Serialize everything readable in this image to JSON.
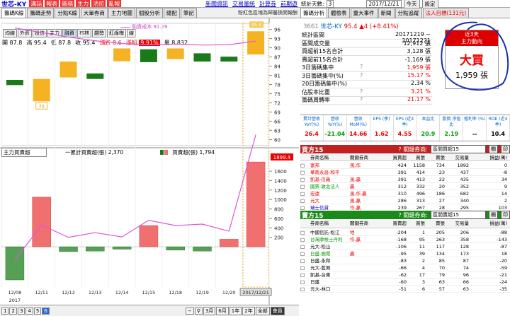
{
  "header": {
    "symbol": "世芯-KY",
    "buttons": [
      "溝話",
      "報表",
      "圖務",
      "主力",
      "活拉",
      "亂報"
    ],
    "links": [
      "新聞資訊",
      "交易量統",
      "計算券",
      "前期遊"
    ],
    "tabs": [
      "籌碼K線",
      "籌碼走勢",
      "分點K線",
      "大單券商",
      "主力地圖",
      "個股分析",
      "總配",
      "筆記"
    ],
    "subtitle": "粉紅色區塊為歸屬換開報酬"
  },
  "right_header": {
    "label": "統計天數:",
    "days": "3",
    "date": "2017/12/21",
    "today": "今天",
    "settings": "設定",
    "tabs": [
      "籌碼分析",
      "體檢表",
      "重大事件",
      "新聞",
      "分點追蹤",
      "法人目標(131元)"
    ]
  },
  "chart": {
    "legend": "融資成本 91.29",
    "tools": [
      "均線",
      "外資",
      "投信",
      "主力",
      "融資",
      "布林",
      "趨勢",
      "紅綠梅",
      "線"
    ],
    "info": {
      "open": "開 87.8",
      "high": "高 95.4",
      "low": "低 87.8",
      "close": "收 95.4",
      "chg": "漲跌 8.6",
      "pct_label": "漲幅",
      "pct": "9.91%",
      "vol": "量 8,832"
    },
    "yticks_upper": [
      "96",
      "93",
      "90",
      "87",
      "84",
      "81",
      "78",
      "75",
      "72",
      "69",
      "66",
      "63",
      "60"
    ],
    "bubble_upper": "95.4",
    "bubble_72": "72",
    "lower_select": "主力買賣超",
    "lower_cum": "一累計買賣超(張) 2,370",
    "lower_day": "買賣超(張) 1,794",
    "yticks_lower": [
      "1600",
      "1400",
      "1200",
      "1000",
      "800",
      "600",
      "400",
      "200"
    ],
    "bubble_lower": "1899.4",
    "xlabels": [
      "12/08",
      "12/11",
      "12/12",
      "12/13",
      "12/14",
      "12/15",
      "12/18",
      "12/19",
      "12/20",
      "2017/12/21"
    ],
    "year": "2017",
    "colors": {
      "up": "#f5b324",
      "down": "#1a7a1a",
      "bar_pos": "#f07070",
      "bar_neg": "#55a055",
      "ma": "#dd55dd"
    }
  },
  "chart_data": {
    "type": "bar",
    "categories": [
      "12/08",
      "12/11",
      "12/12",
      "12/13",
      "12/14",
      "12/15",
      "12/18",
      "12/19",
      "12/20",
      "2017/12/21"
    ],
    "candles": [
      {
        "open": 79.5,
        "close": 77.8,
        "high": 79.5,
        "low": 77.8
      },
      {
        "open": 72.5,
        "close": 79.8,
        "high": 79.8,
        "low": 72.5
      },
      {
        "open": 80.3,
        "close": 85.5,
        "high": 85.5,
        "low": 80.3
      },
      {
        "open": 81.6,
        "close": 79.8,
        "high": 81.6,
        "low": 79.8
      },
      {
        "open": 85.6,
        "close": 89.8,
        "high": 89.8,
        "low": 85.6
      },
      {
        "open": 89.5,
        "close": 85.3,
        "high": 89.5,
        "low": 85.3
      },
      {
        "open": 86.3,
        "close": 89.8,
        "high": 89.8,
        "low": 86.3
      },
      {
        "open": 88.2,
        "close": 85.5,
        "high": 88.2,
        "low": 85.5
      },
      {
        "open": 87.1,
        "close": 85.5,
        "high": 87.1,
        "low": 85.5
      },
      {
        "open": 87.8,
        "close": 95.4,
        "high": 95.4,
        "low": 87.8
      }
    ],
    "ma": [
      96.5,
      95.0,
      93.5,
      92.3,
      91.4,
      91.0,
      91.2,
      90.9,
      91.0,
      92.2
    ],
    "bars": [
      -700,
      1050,
      -100,
      -90,
      -50,
      450,
      -70,
      -90,
      160,
      1794
    ],
    "cum": [
      -280,
      460,
      200,
      300,
      210,
      560,
      450,
      480,
      330,
      2370
    ],
    "ylim_upper": [
      58,
      98
    ],
    "ylim_lower": [
      -850,
      1900
    ]
  },
  "stats": {
    "symbol_code": "3661",
    "symbol_name": "世芯-KY",
    "symbol_price": "95.4",
    "symbol_chg": "▲4 (+8.41%)",
    "rows": [
      {
        "label": "統計區間",
        "val": "20171219 ~ 20171221",
        "color": ""
      },
      {
        "label": "區間成交量",
        "val": "12,912 張",
        "color": ""
      },
      {
        "label": "買超前15名合計",
        "val": "3,128 張",
        "color": ""
      },
      {
        "label": "賣超前15名合計",
        "val": "-1,169 張",
        "color": ""
      },
      {
        "label": "3日籌碼集中",
        "val": "1,959 張",
        "color": "red"
      },
      {
        "label": "3日籌碼集中(%)",
        "val": "15.17 %",
        "color": "red"
      },
      {
        "label": "20日籌碼集中(%)",
        "val": "2.34 %",
        "color": ""
      },
      {
        "label": "佔股本比重",
        "val": "3.21 %",
        "color": "red"
      },
      {
        "label": "籌碼周轉率",
        "val": "21.17 %",
        "color": "red"
      }
    ],
    "callout_h1": "近3天",
    "callout_h2": "主力動向",
    "callout_big": "大買",
    "callout_num": "1,959 張"
  },
  "metrics": [
    {
      "h": "累計營收 YoY(%)",
      "v": "26.4",
      "c": "red"
    },
    {
      "h": "營收 YoY(%)",
      "v": "-21.04",
      "c": "grn"
    },
    {
      "h": "營收 MoM(%)",
      "v": "14.66",
      "c": "red"
    },
    {
      "h": "EPS (季)",
      "v": "1.62",
      "c": "red"
    },
    {
      "h": "EPS (近4季)",
      "v": "4.55",
      "c": "red"
    },
    {
      "h": "本益比",
      "v": "20.9",
      "c": "grn"
    },
    {
      "h": "股價 淨值比",
      "v": "2.19",
      "c": "grn"
    },
    {
      "h": "殖利率 (%)",
      "v": "--",
      "c": ""
    },
    {
      "h": "ROE (近4季)",
      "v": "10.4",
      "c": ""
    }
  ],
  "buy_table": {
    "title": "買方15",
    "sort_label": "? 關鍵券商:",
    "sort_value": "區間買超15",
    "btn1": "欄",
    "btn2": "印",
    "cols": [
      "券商名稱",
      "關鍵券商",
      "買賣超",
      "買張",
      "賣張",
      "交易量",
      "損益(萬)"
    ],
    "rows": [
      [
        "富邦",
        "風,作",
        "424",
        "1158",
        "734",
        "1892",
        "0",
        "red"
      ],
      [
        "華南永昌-和平",
        "",
        "391",
        "414",
        "23",
        "437",
        "-8",
        "red"
      ],
      [
        "凱基-信義",
        "風,贏",
        "391",
        "413",
        "22",
        "435",
        "34",
        "red"
      ],
      [
        "國票-敦北法人",
        "贏",
        "312",
        "332",
        "20",
        "352",
        "9",
        "grn"
      ],
      [
        "宏遠",
        "風,作,贏",
        "310",
        "496",
        "186",
        "682",
        "14",
        "red"
      ],
      [
        "元大",
        "風,贏",
        "286",
        "313",
        "27",
        "340",
        "2",
        "red"
      ],
      [
        "瑞士信貸",
        "作,贏",
        "239",
        "267",
        "28",
        "295",
        "103",
        "blu"
      ],
      [
        "國泰-桃園",
        "",
        "176",
        "184",
        "8",
        "192",
        "32",
        ""
      ],
      [
        "港商野村",
        "",
        "160",
        "160",
        "0",
        "160",
        "-9",
        ""
      ]
    ]
  },
  "sell_table": {
    "title": "賣方15",
    "sort_label": "? 關鍵券商:",
    "sort_value": "區間賣超15",
    "btn1": "欄",
    "btn2": "印",
    "cols": [
      "券商名稱",
      "關鍵券商",
      "買賣超",
      "買張",
      "賣張",
      "交易量",
      "損益(萬)"
    ],
    "rows": [
      [
        "中國信託-松江",
        "地",
        "-204",
        "1",
        "205",
        "206",
        "-88",
        ""
      ],
      [
        "台灣摩根士丹利",
        "作,贏",
        "-168",
        "95",
        "263",
        "358",
        "-143",
        "grn"
      ],
      [
        "元大-松山",
        "",
        "-106",
        "11",
        "117",
        "128",
        "-87",
        ""
      ],
      [
        "日盛-圓覺",
        "贏",
        "-95",
        "39",
        "134",
        "173",
        "18",
        "grn"
      ],
      [
        "日盛-永和",
        "",
        "-83",
        "2",
        "85",
        "87",
        "-20",
        ""
      ],
      [
        "元大-藍興",
        "",
        "-66",
        "4",
        "70",
        "74",
        "-59",
        ""
      ],
      [
        "凱基-台東",
        "",
        "-62",
        "17",
        "79",
        "96",
        "-21",
        ""
      ],
      [
        "日盛",
        "",
        "-60",
        "3",
        "63",
        "66",
        "-24",
        ""
      ],
      [
        "元大-林口",
        "",
        "-51",
        "6",
        "57",
        "63",
        "-35",
        ""
      ]
    ]
  },
  "bottom": {
    "nums": [
      "1",
      "2",
      "3",
      "4",
      "5",
      "6"
    ],
    "periods": [
      "3月",
      "6月",
      "1年",
      "2年",
      "全部",
      "會員"
    ]
  }
}
